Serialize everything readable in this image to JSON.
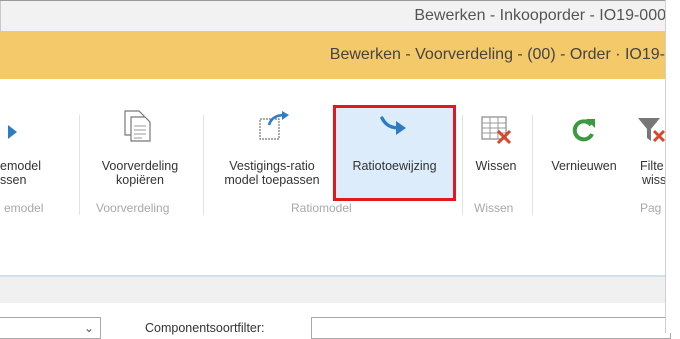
{
  "window": {
    "title": "Bewerken - Inkooporder - IO19-000"
  },
  "page": {
    "title": "Bewerken - Voorverdeling - (00) - Order · IO19-"
  },
  "ribbon": {
    "items": [
      {
        "label_line1": "emodel",
        "label_line2": "ssen",
        "icon": "arrow-right-icon"
      },
      {
        "label_line1": "Voorverdeling",
        "label_line2": "kopiëren",
        "icon": "copy-document-icon"
      },
      {
        "label_line1": "Vestigings-ratio",
        "label_line2": "model toepassen",
        "icon": "apply-template-icon"
      },
      {
        "label_line1": "Ratiotoewijzing",
        "label_line2": "",
        "icon": "assign-arrow-icon"
      },
      {
        "label_line1": "Wissen",
        "label_line2": "",
        "icon": "clear-grid-icon"
      },
      {
        "label_line1": "Vernieuwen",
        "label_line2": "",
        "icon": "refresh-icon"
      },
      {
        "label_line1": "Filte",
        "label_line2": "wiss",
        "icon": "clear-filter-icon"
      }
    ],
    "groups": [
      {
        "label": "emodel"
      },
      {
        "label": "Voorverdeling"
      },
      {
        "label": "Ratiomodel"
      },
      {
        "label": "Wissen"
      },
      {
        "label": "Pag"
      }
    ]
  },
  "filters": {
    "dropdown_value": "",
    "component_label": "Componentsoortfilter:",
    "component_value": ""
  },
  "colors": {
    "accent_bar": "#f4c96a",
    "highlight_border": "#e0191d",
    "icon_blue": "#2e7dc4",
    "icon_green": "#3a9a42",
    "icon_red": "#d9462c"
  }
}
